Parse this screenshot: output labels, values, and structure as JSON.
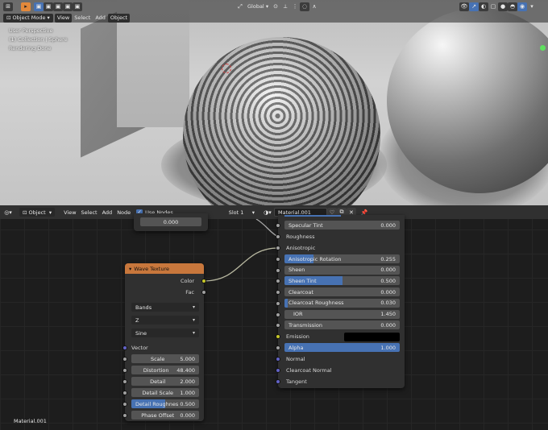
{
  "viewport": {
    "mode": "Object Mode",
    "menus": [
      "View",
      "Select",
      "Add",
      "Object"
    ],
    "transform_orientation": "Global",
    "overlay_lines": [
      "User Perspective",
      "(1) Collection | Sphere",
      "Rendering Done"
    ]
  },
  "node_editor": {
    "editor_type": "Object",
    "menus": [
      "View",
      "Select",
      "Add",
      "Node"
    ],
    "use_nodes_label": "Use Nodes",
    "slot": "Slot 1",
    "material": "Material.001",
    "footer_material": "Material.001"
  },
  "partial_node": {
    "value": "0.000"
  },
  "wave_node": {
    "title": "Wave Texture",
    "outputs": [
      "Color",
      "Fac"
    ],
    "dropdowns": [
      "Bands",
      "Z",
      "Sine"
    ],
    "vector_label": "Vector",
    "fields": [
      {
        "label": "Scale",
        "value": "5.000"
      },
      {
        "label": "Distortion",
        "value": "48.400"
      },
      {
        "label": "Detail",
        "value": "2.000"
      },
      {
        "label": "Detail Scale",
        "value": "1.000"
      },
      {
        "label": "Detail Roughnes",
        "value": "0.500"
      },
      {
        "label": "Phase Offset",
        "value": "0.000"
      }
    ]
  },
  "bsdf_node": {
    "specular_tint": {
      "label": "Specular Tint",
      "value": "0.000"
    },
    "roughness_label": "Roughness",
    "anisotropic_label": "Anisotropic",
    "fields": [
      {
        "label": "Anisotropic Rotation",
        "value": "0.255",
        "fill": 0.255
      },
      {
        "label": "Sheen",
        "value": "0.000",
        "fill": 0
      },
      {
        "label": "Sheen Tint",
        "value": "0.500",
        "fill": 0.5
      },
      {
        "label": "Clearcoat",
        "value": "0.000",
        "fill": 0
      },
      {
        "label": "Clearcoat Roughness",
        "value": "0.030",
        "fill": 0.03
      },
      {
        "label": "IOR",
        "value": "1.450",
        "fill": 0
      },
      {
        "label": "Transmission",
        "value": "0.000",
        "fill": 0
      }
    ],
    "emission_label": "Emission",
    "emission_color": "#000000",
    "alpha": {
      "label": "Alpha",
      "value": "1.000",
      "fill": 1
    },
    "normal_label": "Normal",
    "clearcoat_normal_label": "Clearcoat Normal",
    "tangent_label": "Tangent"
  },
  "colors": {
    "accent_blue": "#4772b3",
    "node_header_orange": "#c8773c",
    "socket_yellow": "#c7c729",
    "socket_purple": "#6363c7",
    "socket_gray": "#a1a1a1"
  }
}
